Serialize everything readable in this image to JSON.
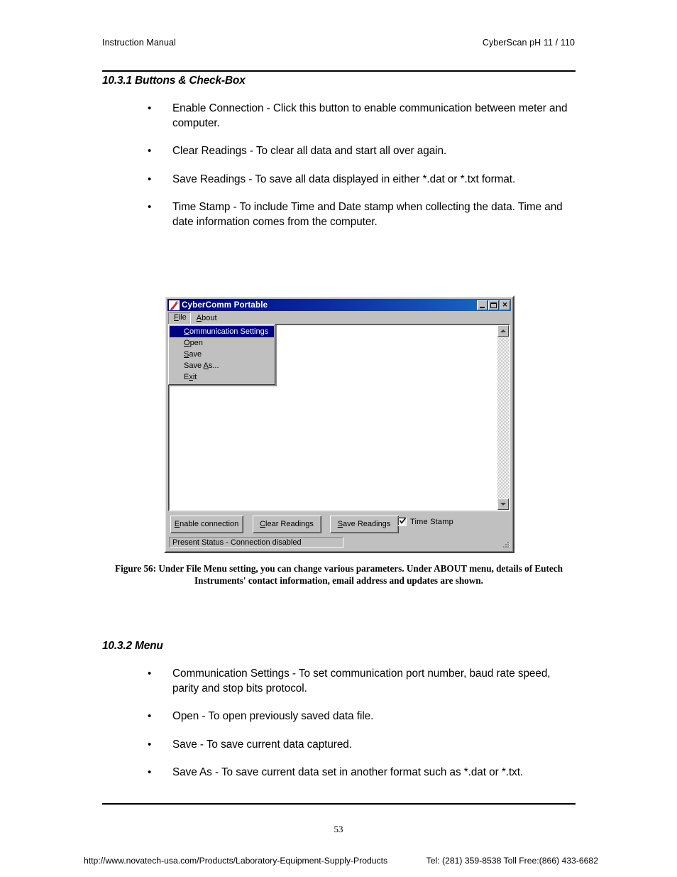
{
  "header": {
    "left": "Instruction Manual",
    "right": "CyberScan pH 11 / 110"
  },
  "sections": {
    "buttons_checkbox": {
      "heading": "10.3.1 Buttons & Check-Box",
      "bullet_marker": "•",
      "items": [
        "Enable Connection - Click this button to enable communication between meter and computer.",
        "Clear Readings - To clear all data and start all over again.",
        "Save Readings - To save all data displayed in either *.dat or *.txt format.",
        "Time Stamp - To include Time and Date stamp when collecting the data. Time and date information comes from the computer."
      ]
    },
    "menu": {
      "heading": "10.3.2 Menu",
      "items": [
        "Communication Settings - To set communication port number, baud rate speed, parity and stop bits protocol.",
        "Open - To open previously saved data file.",
        "Save - To save current data captured.",
        "Save As - To save current data set in another format such as *.dat or *.txt."
      ]
    }
  },
  "figure": {
    "caption": "Figure 56: Under File Menu setting, you can change various parameters. Under ABOUT menu, details of Eutech Instruments' contact information, email address and updates are shown."
  },
  "app_window": {
    "title": "CyberComm Portable",
    "title_icon": "app-pen-icon",
    "window_buttons": [
      {
        "name": "minimize",
        "glyph": "_"
      },
      {
        "name": "maximize",
        "glyph": "□"
      },
      {
        "name": "close",
        "glyph": "✕"
      }
    ],
    "menubar": [
      {
        "label": "File",
        "accel": "F",
        "open": true
      },
      {
        "label": "About",
        "accel": "A",
        "open": false
      }
    ],
    "file_menu": {
      "items": [
        {
          "label": "Communication Settings",
          "accel": "C",
          "selected": true
        },
        {
          "label": "Open",
          "accel": "O",
          "selected": false
        },
        {
          "label": "Save",
          "accel": "S",
          "selected": false
        },
        {
          "label": "Save As...",
          "accel": "A",
          "selected": false
        },
        {
          "label": "Exit",
          "accel": "x",
          "selected": false
        }
      ]
    },
    "output_text": "",
    "buttons": [
      {
        "label": "Enable connection",
        "accel": "E"
      },
      {
        "label": "Clear Readings",
        "accel": "C"
      },
      {
        "label": "Save Readings",
        "accel": "S"
      }
    ],
    "checkbox": {
      "label": "Time Stamp",
      "checked": true
    },
    "status": "Present Status - Connection disabled",
    "colors": {
      "titlebar_start": "#00007b",
      "titlebar_end": "#1b6fc4",
      "face": "#c0c0c0",
      "menu_highlight": "#000080",
      "client": "#ffffff"
    }
  },
  "footer": {
    "page_number": "53",
    "url": "http://www.novatech-usa.com/Products/Laboratory-Equipment-Supply-Products",
    "contact": "Tel: (281) 359-8538  Toll Free:(866) 433-6682"
  }
}
